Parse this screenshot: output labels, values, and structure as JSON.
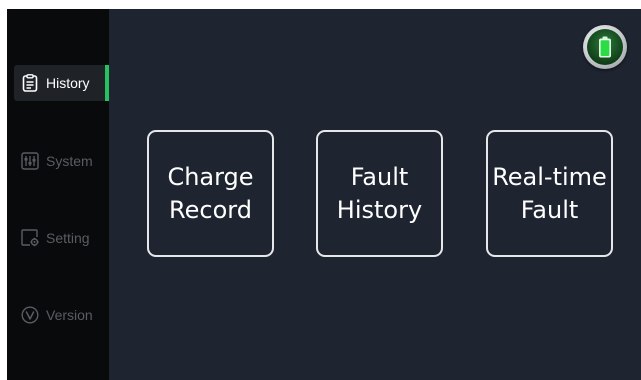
{
  "sidebar": {
    "items": [
      {
        "label": "History",
        "icon": "clipboard-icon",
        "active": true
      },
      {
        "label": "System",
        "icon": "sliders-icon",
        "active": false
      },
      {
        "label": "Setting",
        "icon": "window-gear-icon",
        "active": false
      },
      {
        "label": "Version",
        "icon": "version-check-icon",
        "active": false
      }
    ]
  },
  "main": {
    "cards": [
      {
        "line1": "Charge",
        "line2": "Record"
      },
      {
        "line1": "Fault",
        "line2": "History"
      },
      {
        "line1": "Real-time",
        "line2": "Fault"
      }
    ]
  },
  "status": {
    "battery_icon": "battery-icon"
  },
  "colors": {
    "background": "#1e2430",
    "sidebar": "#090a0c",
    "accent": "#25c25f",
    "inactive_text": "#595d63"
  }
}
